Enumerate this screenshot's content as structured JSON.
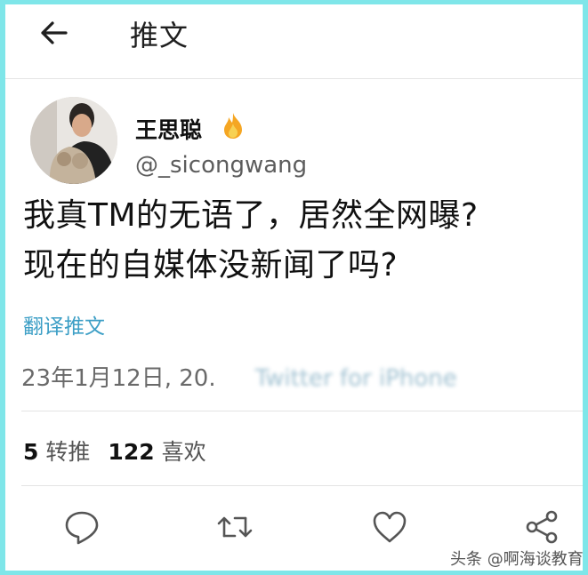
{
  "header": {
    "title": "推文"
  },
  "author": {
    "display_name": "王思聪",
    "handle": "@_sicongwang",
    "badge_icon": "fire-emoji-icon"
  },
  "tweet": {
    "line1": "我真TM的无语了，居然全网曝?",
    "line2": "现在的自媒体没新闻了吗?",
    "translate_label": "翻译推文",
    "date": "23年1月12日, 20.",
    "source": "Twitter for iPhone"
  },
  "stats": {
    "retweets": "5",
    "retweets_label": "转推",
    "likes": "122",
    "likes_label": "喜欢"
  },
  "actions": {
    "icons": [
      "reply-icon",
      "retweet-icon",
      "like-icon",
      "share-icon"
    ]
  },
  "watermark": {
    "text": "头条 @啊海谈教育"
  },
  "colors": {
    "border": "#7fe6e9",
    "link": "#3d9fc6",
    "fire": "#f5a623"
  }
}
